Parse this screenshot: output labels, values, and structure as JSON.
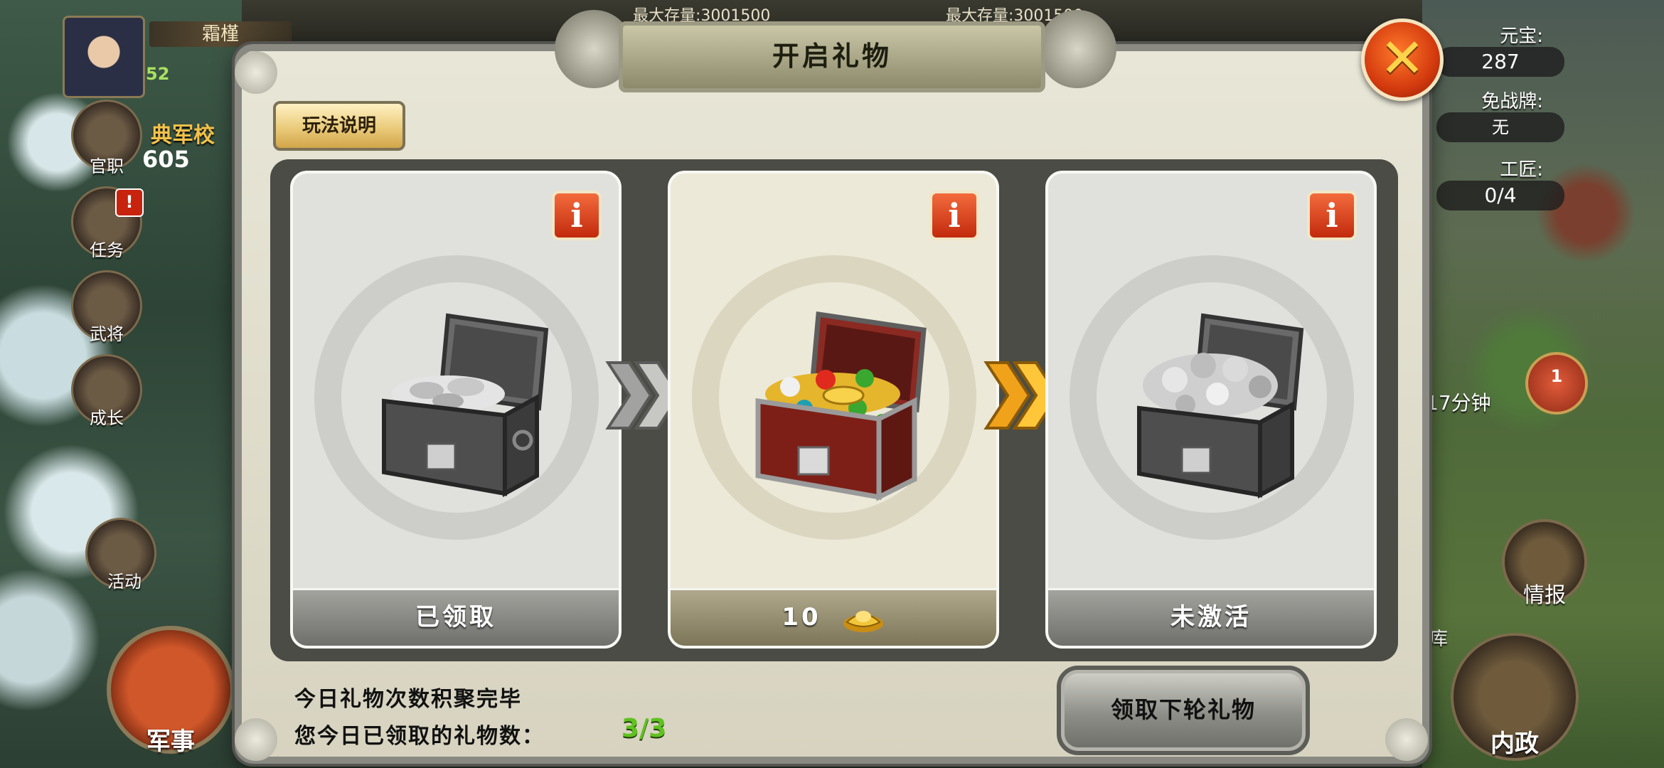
{
  "hud": {
    "player_name": "霜槿",
    "level": "52",
    "title": "典军校",
    "stat_value": "605",
    "storage_left": "最大存量:3001500",
    "storage_right": "最大存量:3001500",
    "sidebar": [
      {
        "label": "官职",
        "icon": "official-rank-icon"
      },
      {
        "label": "任务",
        "icon": "quest-scroll-icon",
        "badge": "!"
      },
      {
        "label": "武将",
        "icon": "general-helmet-icon"
      },
      {
        "label": "成长",
        "icon": "growth-icon"
      },
      {
        "label": "活动",
        "icon": "event-lantern-icon"
      }
    ],
    "military_label": "军事",
    "right": {
      "yuanbao_label": "元宝:",
      "yuanbao_value": "287",
      "badge_label": "免战牌:",
      "badge_value": "无",
      "craftsman_label": "工匠:",
      "craftsman_value": "0/4",
      "timer": "17分钟",
      "notice_count": "1",
      "intel_label": "情报",
      "domestic_label": "内政",
      "storage_label": "库"
    }
  },
  "dialog": {
    "title": "开启礼物",
    "close_icon": "close-x-icon",
    "help_label": "玩法说明",
    "cards": [
      {
        "status": "已领取",
        "chest": "silver-chest-open-icon",
        "state": "claimed"
      },
      {
        "cost": "10",
        "currency_icon": "gold-ingot-icon",
        "chest": "jewel-chest-open-icon",
        "state": "active"
      },
      {
        "status": "未激活",
        "chest": "silver-chest-full-icon",
        "state": "inactive"
      }
    ],
    "info_label": "i",
    "status_line_1": "今日礼物次数积聚完毕",
    "status_line_2": "您今日已领取的礼物数：",
    "claimed_count": "3/3",
    "next_button": "领取下轮礼物"
  },
  "colors": {
    "count_green": "#5fc21f",
    "close_red": "#d33a0e",
    "arrow_active": "#f0a21a",
    "arrow_inactive": "#9a9a98"
  }
}
